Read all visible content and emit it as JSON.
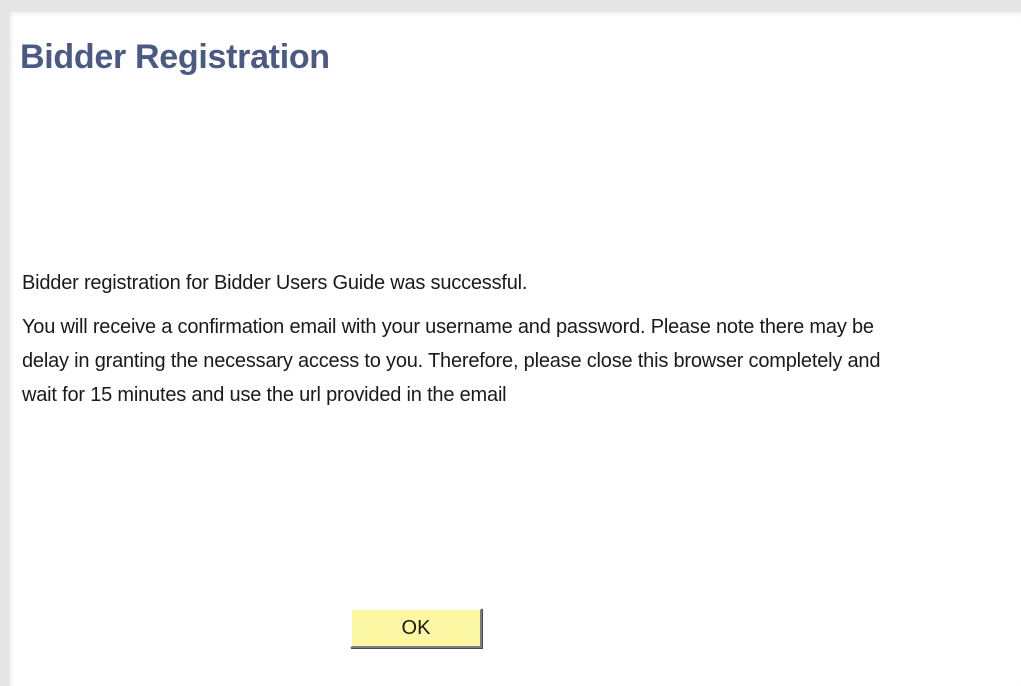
{
  "page": {
    "title": "Bidder Registration"
  },
  "message": {
    "line1": "Bidder registration for Bidder Users Guide was successful.",
    "line2": "You will receive a confirmation email with your username and password.  Please note there may be",
    "line3": "delay in granting the necessary access to you.  Therefore, please close this browser completely and",
    "line4": "wait for 15 minutes and use the url provided in the email"
  },
  "actions": {
    "ok_label": "OK"
  },
  "colors": {
    "title": "#4b5a82",
    "button_bg": "#fbf7a2",
    "frame_border": "#e6e6e6"
  }
}
